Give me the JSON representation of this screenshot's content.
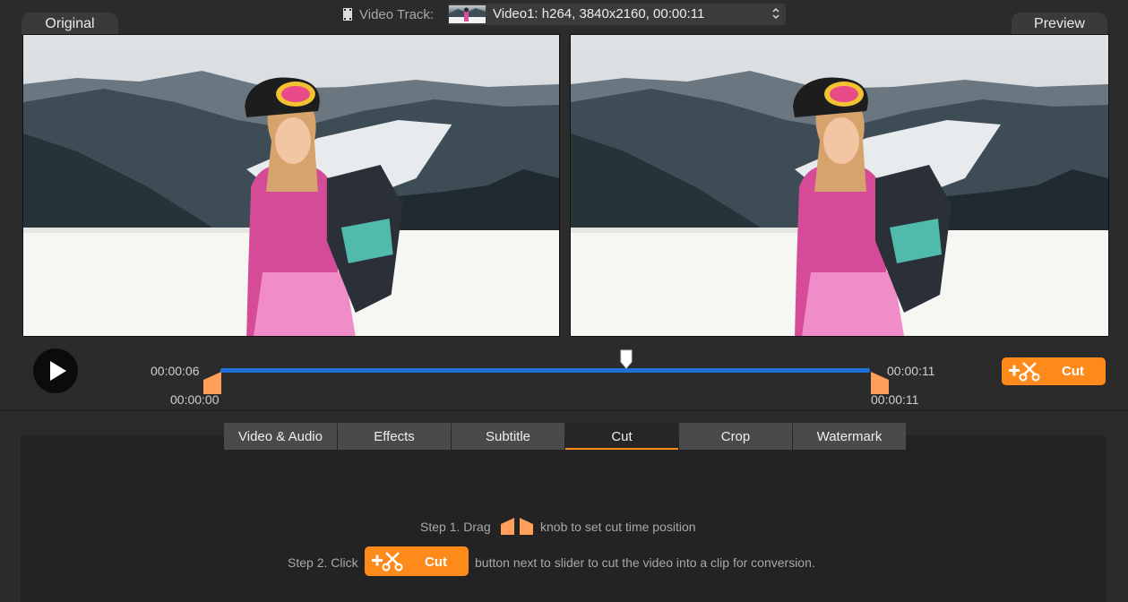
{
  "header": {
    "original_label": "Original",
    "preview_label": "Preview",
    "video_track_label": "Video Track:",
    "video_track_value": "Video1: h264, 3840x2160, 00:00:11"
  },
  "timeline": {
    "start_time_top": "00:00:06",
    "start_time_bottom": "00:00:00",
    "end_time_top": "00:00:11",
    "end_time_bottom": "00:00:11",
    "cut_label": "Cut"
  },
  "tabs": [
    {
      "label": "Video & Audio",
      "active": false
    },
    {
      "label": "Effects",
      "active": false
    },
    {
      "label": "Subtitle",
      "active": false
    },
    {
      "label": "Cut",
      "active": true
    },
    {
      "label": "Crop",
      "active": false
    },
    {
      "label": "Watermark",
      "active": false
    }
  ],
  "instructions": {
    "step1_prefix": "Step 1. Drag",
    "step1_suffix": "knob to set cut time position",
    "step2_prefix": "Step 2. Click",
    "step2_button": "Cut",
    "step2_suffix": "button next to slider to cut the video into a clip for conversion."
  },
  "colors": {
    "accent": "#ff8a1c",
    "slider": "#1f6fd6",
    "background": "#2b2b2b",
    "panel": "#232323",
    "tab": "#4a4a4a"
  },
  "icons": {
    "play": "play-icon",
    "cut": "scissors-plus-icon",
    "knob": "trim-knob-icon",
    "track": "film-strip-icon",
    "select_arrows": "up-down-chevron-icon"
  }
}
